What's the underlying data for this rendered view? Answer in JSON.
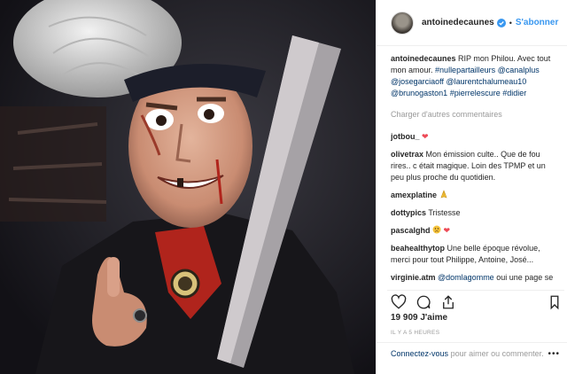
{
  "header": {
    "username": "antoinedecaunes",
    "separator": "•",
    "follow_label": "S'abonner"
  },
  "caption": {
    "username": "antoinedecaunes",
    "text": "RIP mon Philou. Avec tout mon amour.",
    "tags": [
      "#nullepartailleurs",
      "@canalplus",
      "@josegarciaoff",
      "@laurentchalumeau10",
      "@brunogaston1",
      "#pierrelescure",
      "#didier"
    ]
  },
  "load_more": "Charger d'autres commentaires",
  "comments": [
    {
      "user": "jotbou_",
      "text": "",
      "emoji": "heart"
    },
    {
      "user": "olivetrax",
      "text": "Mon émission culte.. Que de fou rires.. c était magique. Loin des TPMP et un peu plus proche du quotidien.",
      "emoji": ""
    },
    {
      "user": "amexplatine",
      "text": "",
      "emoji": "pray"
    },
    {
      "user": "dottypics",
      "text": "Tristesse",
      "emoji": ""
    },
    {
      "user": "pascalghd",
      "text": "",
      "emoji": "sad-heart"
    },
    {
      "user": "beahealthytop",
      "text": "Une belle époque révolue, merci pour tout Philippe, Antoine, José...",
      "emoji": ""
    },
    {
      "user": "virginie.atm",
      "text": "oui une page se tourne...",
      "mention": "@domlagomme",
      "emoji": ""
    }
  ],
  "likes": "19 909 J'aime",
  "timestamp": "IL Y A 5 HEURES",
  "login": {
    "link": "Connectez-vous",
    "text": "pour aimer ou commenter."
  },
  "more_label": "•••"
}
